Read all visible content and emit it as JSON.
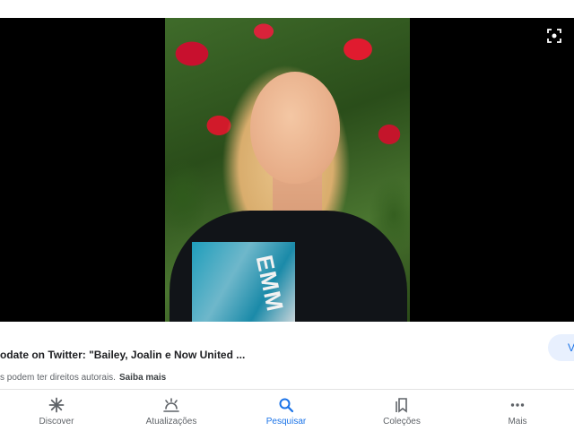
{
  "result": {
    "title": "odate on Twitter: \"Bailey, Joalin e Now United ...",
    "copyright_notice": "s podem ter direitos autorais.",
    "learn_more": "Saiba mais",
    "visit_button_label": "V"
  },
  "viewer": {
    "expand_icon": "lens-scan-icon",
    "shirt_print_text": "EMM"
  },
  "bottom_nav": {
    "items": [
      {
        "label": "Discover",
        "icon": "asterisk-icon",
        "active": false
      },
      {
        "label": "Atualizações",
        "icon": "updates-icon",
        "active": false
      },
      {
        "label": "Pesquisar",
        "icon": "search-icon",
        "active": true
      },
      {
        "label": "Coleções",
        "icon": "collections-icon",
        "active": false
      },
      {
        "label": "Mais",
        "icon": "more-icon",
        "active": false
      }
    ]
  },
  "colors": {
    "accent": "#1a73e8",
    "inactive": "#5f6368",
    "viewer_background": "#000000",
    "visit_button_bg": "#e8f0fe"
  }
}
